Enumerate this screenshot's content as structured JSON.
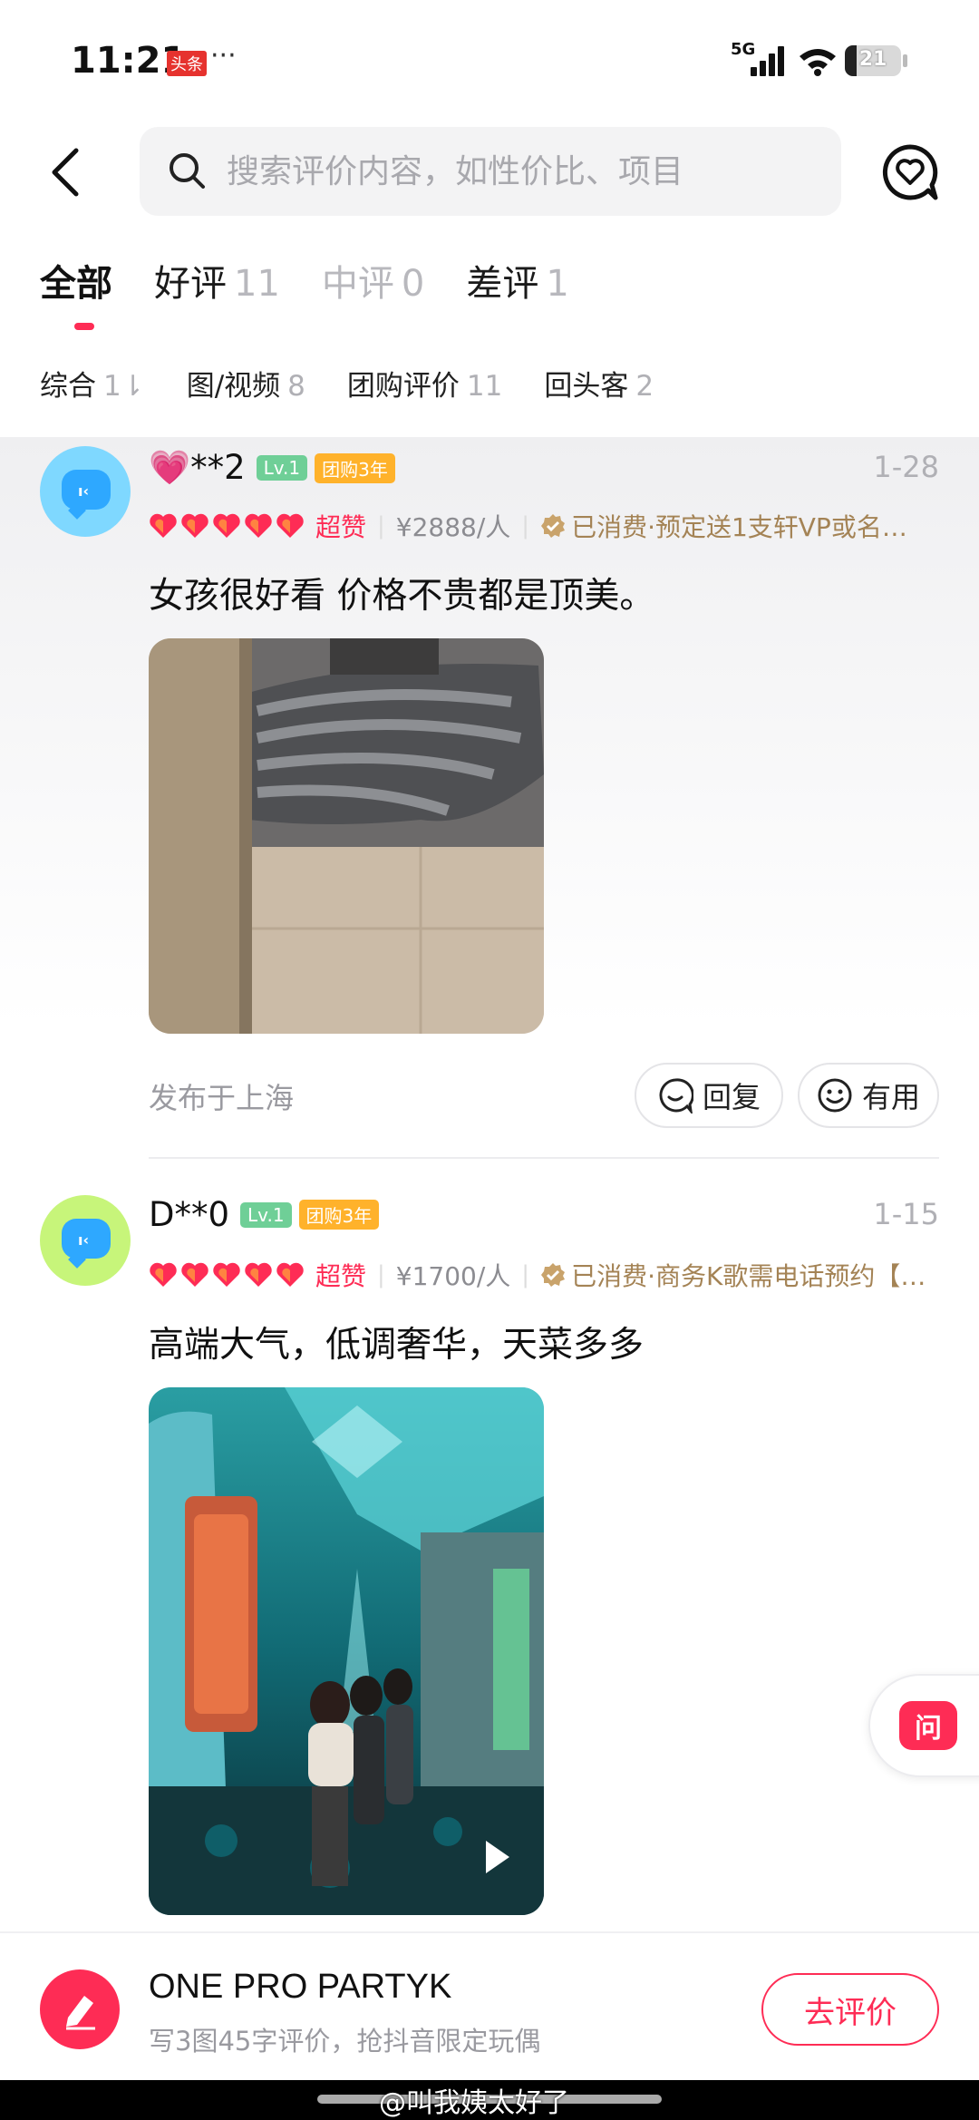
{
  "status": {
    "time": "11:21",
    "app_badge": "头条",
    "more": "···",
    "network": "5G",
    "battery": "21",
    "battery_level": 0.21
  },
  "header": {
    "search_placeholder": "搜索评价内容，如性价比、项目"
  },
  "tabs": [
    {
      "label": "全部",
      "count": ""
    },
    {
      "label": "好评",
      "count": "11"
    },
    {
      "label": "中评",
      "count": "0"
    },
    {
      "label": "差评",
      "count": "1"
    }
  ],
  "filters": [
    {
      "label": "综合",
      "count": "1⇂"
    },
    {
      "label": "图/视频",
      "count": "8"
    },
    {
      "label": "团购评价",
      "count": "11"
    },
    {
      "label": "回头客",
      "count": "2"
    }
  ],
  "reviews": [
    {
      "username": "💗**2",
      "level": "Lv.1",
      "group": "团购3年",
      "date": "1-28",
      "rating": "超赞",
      "price": "¥2888/人",
      "consumed": "已消费·预定送1支轩VP或名…",
      "content": "女孩很好看   价格不贵都是顶美。",
      "location": "发布于上海",
      "reply": "回复",
      "useful": "有用",
      "avatar_color": "#7fd8ff"
    },
    {
      "username": "D**0",
      "level": "Lv.1",
      "group": "团购3年",
      "date": "1-15",
      "rating": "超赞",
      "price": "¥1700/人",
      "consumed": "已消费·商务K歌需电话预约【…",
      "content": "高端大气，低调奢华，天菜多多",
      "avatar_color": "#c7f57a"
    }
  ],
  "ask_button": "问",
  "bottom": {
    "shop_name": "ONE PRO PARTYK",
    "subtitle": "写3图45字评价，抢抖音限定玩偶",
    "review_button": "去评价"
  },
  "watermark": "@叫我姨太好了",
  "colors": {
    "accent": "#fe2c55",
    "consumed": "#a48355",
    "level_badge": "#6fcf97",
    "group_badge": "#ffb22b"
  }
}
